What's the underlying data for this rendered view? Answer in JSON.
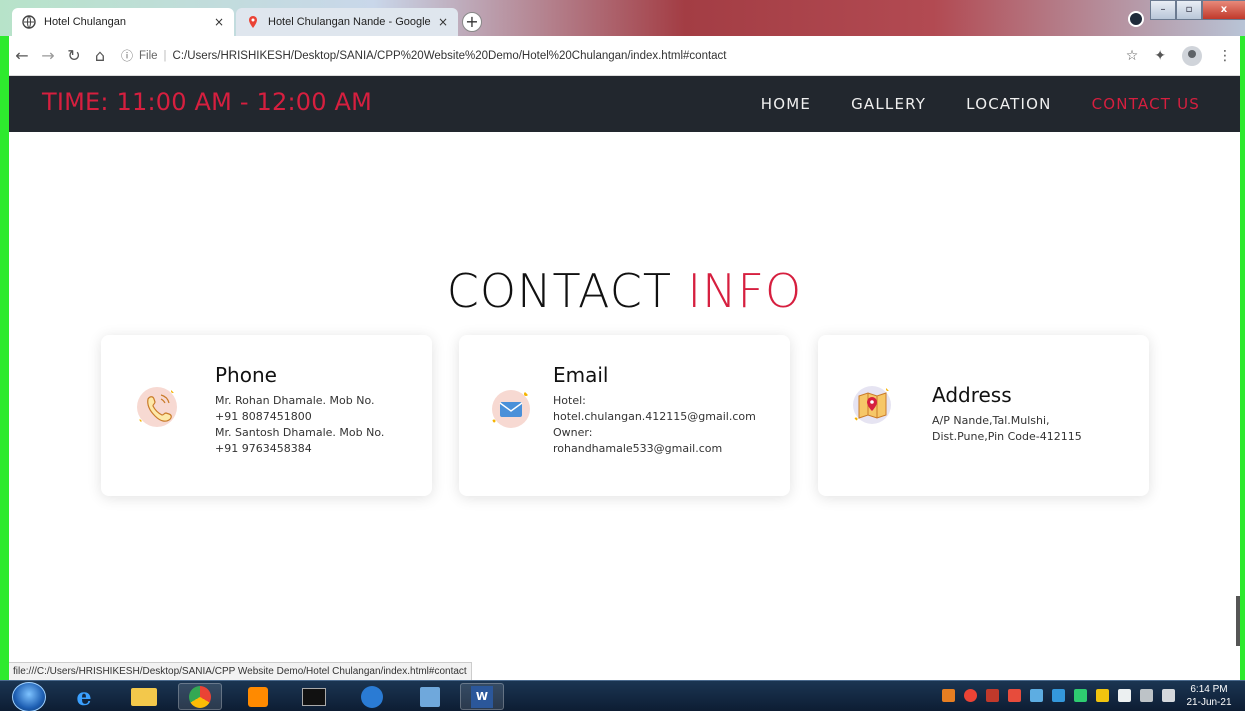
{
  "browser": {
    "tabs": [
      {
        "title": "Hotel Chulangan",
        "close": "×"
      },
      {
        "title": "Hotel Chulangan Nande - Google",
        "close": "×"
      }
    ],
    "new_tab": "+",
    "address": {
      "scheme": "File",
      "url": "C:/Users/HRISHIKESH/Desktop/SANIA/CPP%20Website%20Demo/Hotel%20Chulangan/index.html#contact"
    },
    "status_url": "file:///C:/Users/HRISHIKESH/Desktop/SANIA/CPP Website Demo/Hotel Chulangan/index.html#contact",
    "controls": {
      "minimize": "–",
      "maximize": "▫",
      "close": "x"
    },
    "icons": [
      "back-arrow-icon",
      "forward-arrow-icon",
      "reload-icon",
      "home-icon",
      "info-icon",
      "star-icon",
      "extensions-icon",
      "profile-icon",
      "menu-kebab-icon"
    ]
  },
  "site": {
    "hours": "TIME: 11:00 AM - 12:00 AM",
    "nav": [
      "HOME",
      "GALLERY",
      "LOCATION",
      "CONTACT US"
    ],
    "active_nav": "CONTACT US",
    "heading": {
      "part1": "CONTACT ",
      "part2": "INFO"
    },
    "cards": {
      "phone": {
        "title": "Phone",
        "lines": [
          "Mr. Rohan Dhamale. Mob No.",
          "+91 8087451800",
          "Mr. Santosh Dhamale. Mob No.",
          "+91 9763458384"
        ]
      },
      "email": {
        "title": "Email",
        "lines": [
          "Hotel:",
          "hotel.chulangan.412115@gmail.com",
          "Owner:",
          "rohandhamale533@gmail.com"
        ]
      },
      "address": {
        "title": "Address",
        "lines": [
          "A/P Nande,Tal.Mulshi,",
          "Dist.Pune,Pin Code-412115"
        ]
      }
    },
    "colors": {
      "accent": "#d61f3f",
      "nav_bg": "#22272e"
    }
  },
  "taskbar": {
    "time": "6:14 PM",
    "date": "21-Jun-21"
  }
}
